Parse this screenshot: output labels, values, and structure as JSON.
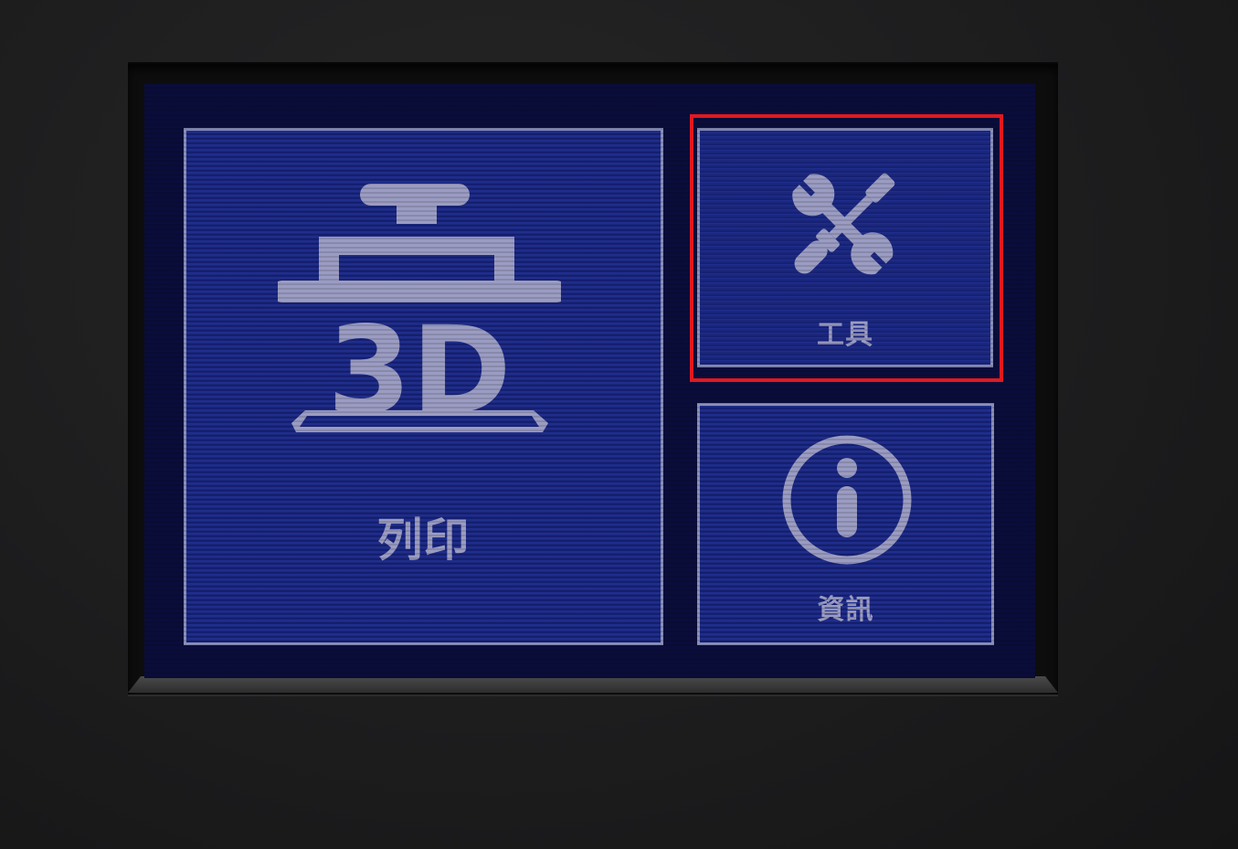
{
  "screen": {
    "tiles": [
      {
        "id": "print",
        "label": "列印",
        "icon": "3d-printer-icon",
        "icon_text": "3D"
      },
      {
        "id": "tools",
        "label": "工具",
        "icon": "tools-icon"
      },
      {
        "id": "info",
        "label": "資訊",
        "icon": "info-icon"
      }
    ]
  },
  "highlight": {
    "target": "tools",
    "color": "#e0191f"
  },
  "colors": {
    "tile_fill": "#1f2d8c",
    "tile_border": "#8a8fb8",
    "icon_and_text": "#9b9cc2",
    "screen_bg": "#0a0d3a"
  }
}
